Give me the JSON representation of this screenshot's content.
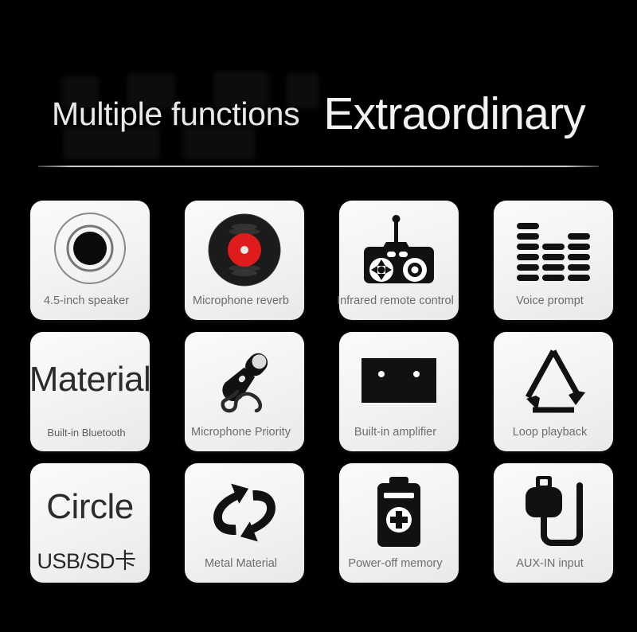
{
  "header": {
    "subtitle": "Multiple functions",
    "title": "Extraordinary"
  },
  "features": [
    {
      "icon": "speaker-cone-icon",
      "label": "4.5-inch speaker",
      "style": "icon"
    },
    {
      "icon": "vinyl-record-icon",
      "label": "Microphone reverb",
      "style": "icon"
    },
    {
      "icon": "remote-control-icon",
      "label": "Infrared remote control",
      "style": "icon"
    },
    {
      "icon": "equalizer-bars-icon",
      "label": "Voice prompt",
      "style": "icon"
    },
    {
      "icon": "text-material-icon",
      "label": "Built-in Bluetooth",
      "style": "word",
      "word": "Material"
    },
    {
      "icon": "microphone-icon",
      "label": "Microphone Priority",
      "style": "icon"
    },
    {
      "icon": "amplifier-icon",
      "label": "Built-in amplifier",
      "style": "icon"
    },
    {
      "icon": "loop-triangle-icon",
      "label": "Loop playback",
      "style": "icon"
    },
    {
      "icon": "text-circle-icon",
      "label": "USB/SD卡",
      "style": "word",
      "word": "Circle"
    },
    {
      "icon": "metal-cycle-arrows-icon",
      "label": "Metal Material",
      "style": "icon"
    },
    {
      "icon": "battery-plus-icon",
      "label": "Power-off memory",
      "style": "icon"
    },
    {
      "icon": "usb-plug-cable-icon",
      "label": "AUX-IN input",
      "style": "icon"
    }
  ],
  "colors": {
    "background": "#000000",
    "card": "#f2f2f2",
    "label_text": "#6d6d6d",
    "heading_text": "#f2f2f2",
    "icon_dark": "#111111",
    "accent_red": "#e01b1b"
  }
}
